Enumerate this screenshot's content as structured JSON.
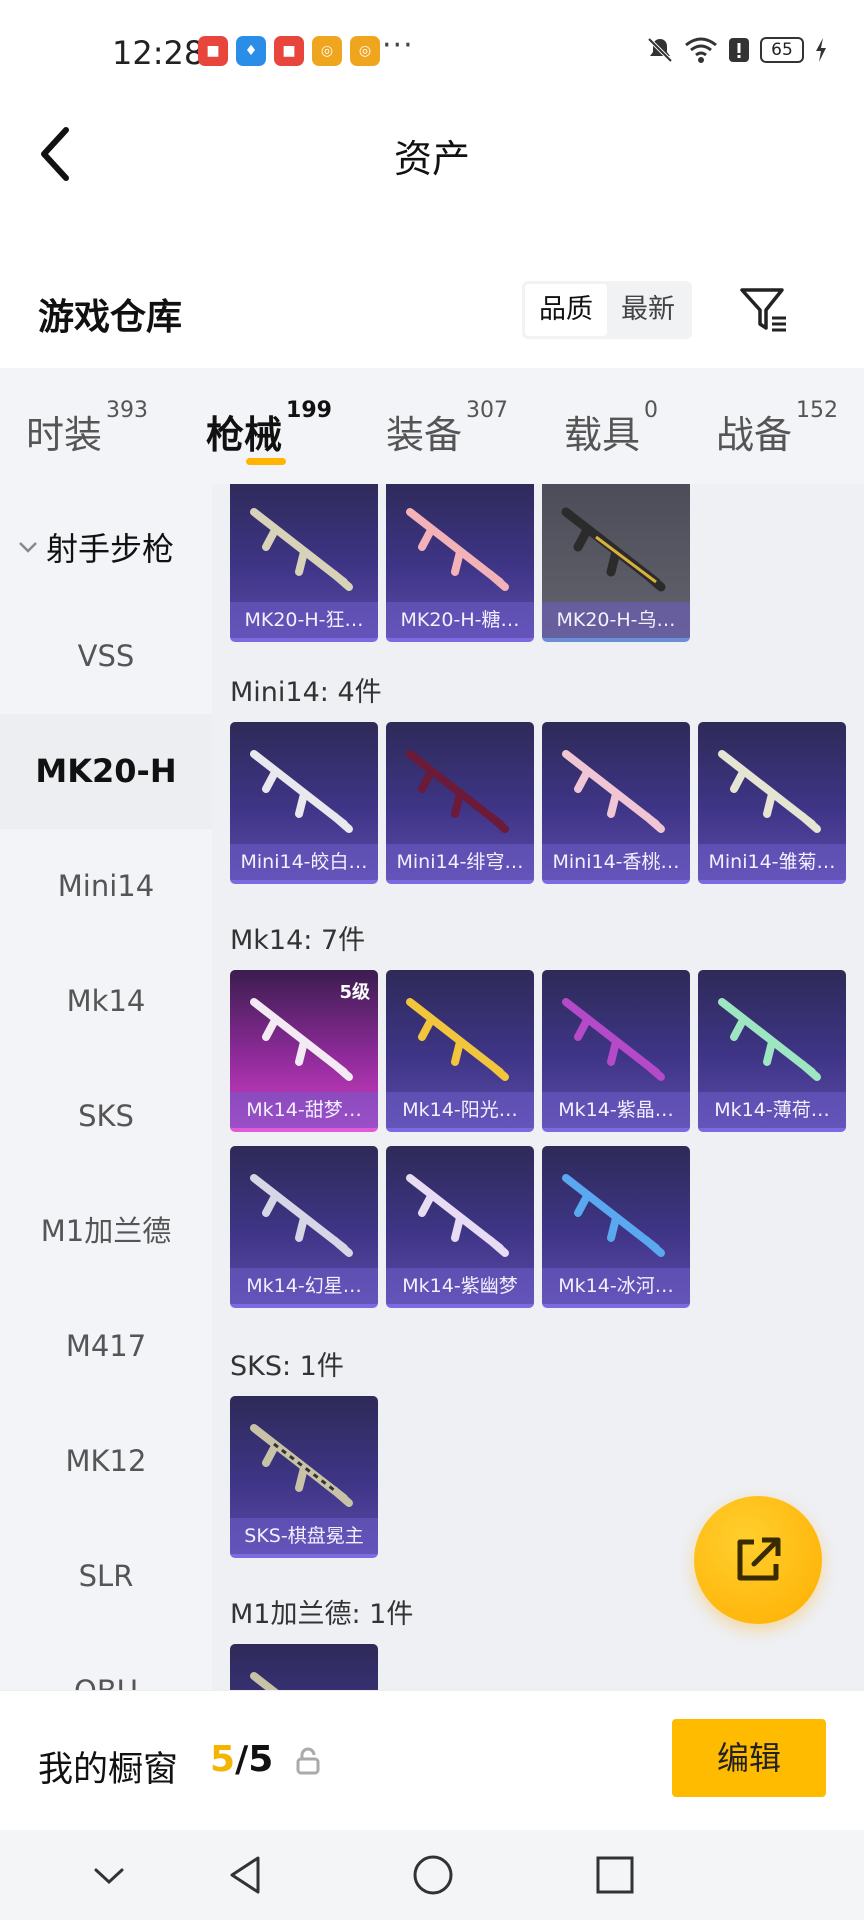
{
  "status_bar": {
    "time": "12:28",
    "app_icons": [
      {
        "name": "huawei-store-icon",
        "color": "#e8453c"
      },
      {
        "name": "shield-app-icon",
        "color": "#2a8de8"
      },
      {
        "name": "huawei-store-icon",
        "color": "#e8453c"
      },
      {
        "name": "game-app-icon",
        "color": "#f0a51f"
      },
      {
        "name": "game-app-icon",
        "color": "#f0a51f"
      }
    ],
    "more": "···",
    "battery": "65"
  },
  "header": {
    "title": "资产"
  },
  "warehouse": {
    "title": "游戏仓库",
    "sort_options": [
      "品质",
      "最新"
    ],
    "active_sort": "品质"
  },
  "category_tabs": [
    {
      "label": "时装",
      "count": "393"
    },
    {
      "label": "枪械",
      "count": "199",
      "active": true
    },
    {
      "label": "装备",
      "count": "307"
    },
    {
      "label": "载具",
      "count": "0"
    },
    {
      "label": "战备",
      "count": "152"
    }
  ],
  "sidebar": {
    "group": "射手步枪",
    "items": [
      "VSS",
      "MK20-H",
      "Mini14",
      "Mk14",
      "SKS",
      "M1加兰德",
      "M417",
      "MK12",
      "SLR",
      "QBU"
    ],
    "active": "MK20-H"
  },
  "content": {
    "top_cards": [
      "MK20-H-狂…",
      "MK20-H-糖…",
      "MK20-H-乌…"
    ],
    "groups": [
      {
        "label": "Mini14: 4件",
        "cards": [
          "Mini14-皎白…",
          "Mini14-绯穹…",
          "Mini14-香桃…",
          "Mini14-雏菊…"
        ]
      },
      {
        "label": "Mk14: 7件",
        "cards": [
          "Mk14-甜梦…",
          "Mk14-阳光…",
          "Mk14-紫晶…",
          "Mk14-薄荷…",
          "Mk14-幻星…",
          "Mk14-紫幽梦",
          "Mk14-冰河…"
        ]
      },
      {
        "label": "SKS: 1件",
        "cards": [
          "SKS-棋盘冕主"
        ]
      },
      {
        "label": "M1加兰德: 1件",
        "cards": [
          ""
        ]
      }
    ],
    "level_badge": "5级"
  },
  "bottom_bar": {
    "label": "我的橱窗",
    "current": "5",
    "separator": "/",
    "total": "5",
    "edit_label": "编辑"
  },
  "colors": {
    "accent": "#ffbb00",
    "card_purple": "#3f3587",
    "card_pink": "#d23fc6"
  }
}
